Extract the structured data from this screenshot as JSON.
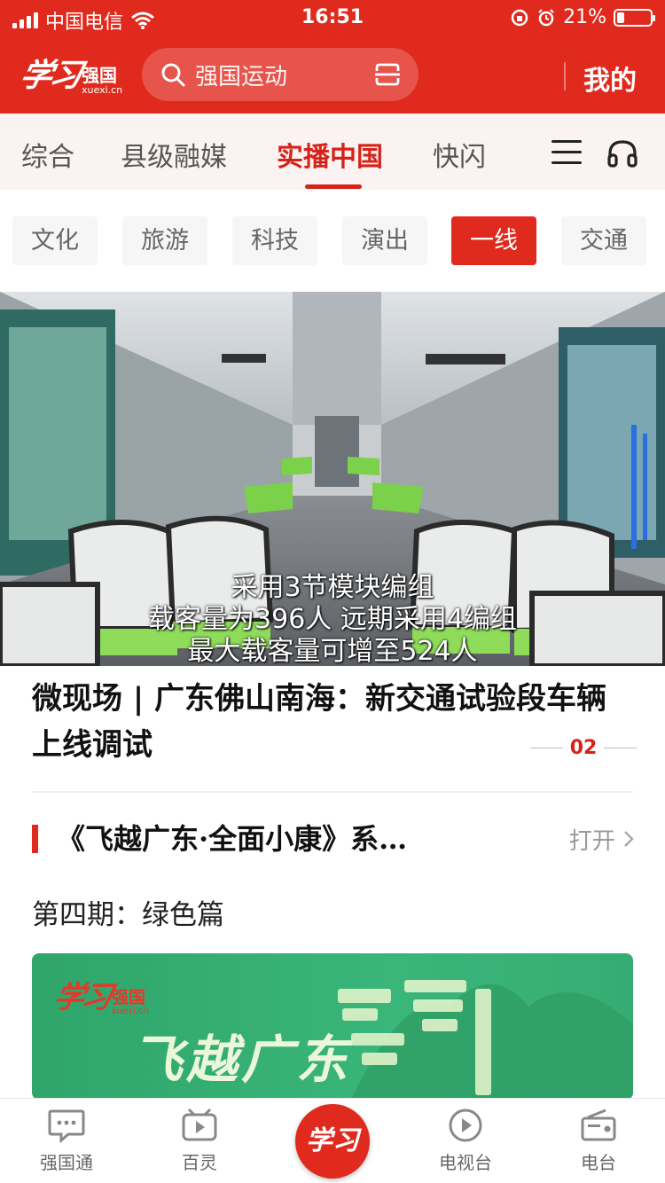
{
  "status_bar": {
    "carrier": "中国电信",
    "time": "16:51",
    "battery": "21%"
  },
  "header": {
    "logo_script": "学习",
    "logo_cn": "强国",
    "logo_en": "xuexi.cn",
    "search_placeholder": "强国运动",
    "mine_label": "我的"
  },
  "channels": {
    "tabs": [
      {
        "label": "综合"
      },
      {
        "label": "县级融媒"
      },
      {
        "label": "实播中国",
        "active": true
      },
      {
        "label": "快闪"
      }
    ]
  },
  "categories": [
    {
      "label": "文化"
    },
    {
      "label": "旅游"
    },
    {
      "label": "科技"
    },
    {
      "label": "演出"
    },
    {
      "label": "一线",
      "active": true
    },
    {
      "label": "交通"
    }
  ],
  "hero": {
    "caption_lines": [
      "采用3节模块编组",
      "载客量为396人 远期采用4编组",
      "最大载客量可增至524人"
    ],
    "title": "微现场 | 广东佛山南海：新交通试验段车辆上线调试",
    "page_index": "02"
  },
  "series": {
    "title": "《飞越广东·全面小康》系…",
    "open_label": "打开",
    "subtitle": "第四期：绿色篇",
    "banner_logo_script": "学习",
    "banner_logo_cn": "强国",
    "banner_logo_en": "xuexi.cn",
    "banner_text": "飞越广东"
  },
  "tabbar": {
    "items": [
      {
        "label": "强国通",
        "icon": "chat-icon"
      },
      {
        "label": "百灵",
        "icon": "video-play-icon"
      },
      {
        "label": "学习",
        "icon": "xuexi-logo"
      },
      {
        "label": "电视台",
        "icon": "play-circle-icon"
      },
      {
        "label": "电台",
        "icon": "radio-icon"
      }
    ]
  },
  "colors": {
    "brand_red": "#e02a1e",
    "active_text": "#d6231a",
    "banner_green": "#3ab67a"
  }
}
